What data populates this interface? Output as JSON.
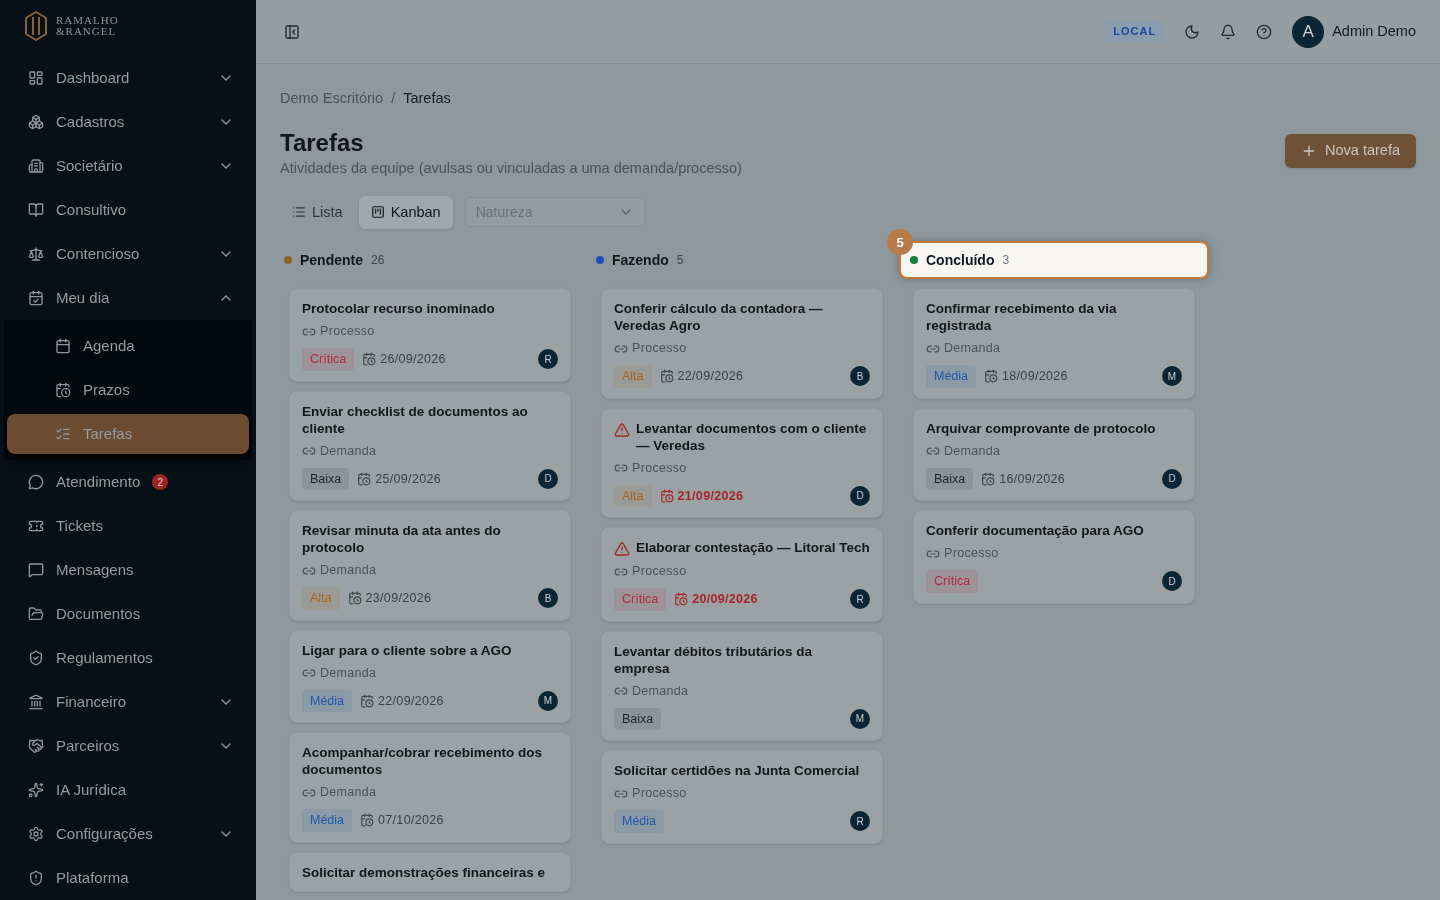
{
  "sidebar": {
    "logo": [
      "RAMALHO",
      "&RANGEL"
    ],
    "items": [
      {
        "label": "Dashboard",
        "expandable": true,
        "expanded": false,
        "selected": false
      },
      {
        "label": "Cadastros",
        "expandable": true,
        "expanded": false,
        "selected": false
      },
      {
        "label": "Societário",
        "expandable": true,
        "expanded": false,
        "selected": false
      },
      {
        "label": "Consultivo",
        "expandable": false,
        "selected": false
      },
      {
        "label": "Contencioso",
        "expandable": true,
        "expanded": false,
        "selected": false
      },
      {
        "label": "Meu dia",
        "expandable": true,
        "expanded": true,
        "selected": false,
        "children": [
          {
            "label": "Agenda",
            "selected": false
          },
          {
            "label": "Prazos",
            "selected": false
          },
          {
            "label": "Tarefas",
            "selected": true
          }
        ]
      },
      {
        "label": "Atendimento",
        "expandable": false,
        "selected": false,
        "badge": "2"
      },
      {
        "label": "Tickets",
        "expandable": false,
        "selected": false
      },
      {
        "label": "Mensagens",
        "expandable": false,
        "selected": false
      },
      {
        "label": "Documentos",
        "expandable": false,
        "selected": false
      },
      {
        "label": "Regulamentos",
        "expandable": false,
        "selected": false
      },
      {
        "label": "Financeiro",
        "expandable": true,
        "expanded": false,
        "selected": false
      },
      {
        "label": "Parceiros",
        "expandable": true,
        "expanded": false,
        "selected": false
      },
      {
        "label": "IA Jurídica",
        "expandable": false,
        "selected": false
      },
      {
        "label": "Configurações",
        "expandable": true,
        "expanded": false,
        "selected": false
      },
      {
        "label": "Plataforma",
        "expandable": false,
        "selected": false
      }
    ]
  },
  "topbar": {
    "environment": "LOCAL",
    "user_initial": "A",
    "user_name": "Admin Demo"
  },
  "breadcrumb": {
    "items": [
      "Demo Escritório",
      "Tarefas"
    ],
    "separator": "/"
  },
  "title": "Tarefas",
  "subtitle": "Atividades da equipe (avulsas ou vinculadas a uma demanda/processo)",
  "new_button": "Nova tarefa",
  "views": [
    {
      "label": "Lista",
      "selected": false
    },
    {
      "label": "Kanban",
      "selected": true
    }
  ],
  "filter": {
    "placeholder": "Natureza"
  },
  "tour": {
    "step": "5"
  },
  "columns": [
    {
      "name": "Pendente",
      "count": "26",
      "color": "#8a6424",
      "highlighted": false,
      "cards": [
        {
          "title": "Protocolar recurso inominado",
          "overdue": false,
          "link": "Processo",
          "priority": {
            "label": "Crítica",
            "color": "#b3283f"
          },
          "date": "26/09/2026",
          "assignee": "R"
        },
        {
          "title": "Enviar checklist de documentos ao cliente",
          "overdue": false,
          "link": "Demanda",
          "priority": {
            "label": "Baixa",
            "color": "#1e2428"
          },
          "date": "25/09/2026",
          "assignee": "D"
        },
        {
          "title": "Revisar minuta da ata antes do protocolo",
          "overdue": false,
          "link": "Demanda",
          "priority": {
            "label": "Alta",
            "color": "#a8641c"
          },
          "date": "23/09/2026",
          "assignee": "B"
        },
        {
          "title": "Ligar para o cliente sobre a AGO",
          "overdue": false,
          "link": "Demanda",
          "priority": {
            "label": "Média",
            "color": "#1f58b0"
          },
          "date": "22/09/2026",
          "assignee": "M"
        },
        {
          "title": "Acompanhar/cobrar recebimento dos documentos",
          "overdue": false,
          "link": "Demanda",
          "priority": {
            "label": "Média",
            "color": "#1f58b0"
          },
          "date": "07/10/2026"
        },
        {
          "title": "Solicitar demonstrações financeiras e",
          "overdue": false
        }
      ]
    },
    {
      "name": "Fazendo",
      "count": "5",
      "color": "#1e4fc0",
      "highlighted": false,
      "cards": [
        {
          "title": "Conferir cálculo da contadora — Veredas Agro",
          "overdue": false,
          "link": "Processo",
          "priority": {
            "label": "Alta",
            "color": "#a8641c"
          },
          "date": "22/09/2026",
          "assignee": "B"
        },
        {
          "title": "Levantar documentos com o cliente — Veredas",
          "overdue": true,
          "link": "Processo",
          "priority": {
            "label": "Alta",
            "color": "#a8641c"
          },
          "date": "21/09/2026",
          "assignee": "D"
        },
        {
          "title": "Elaborar contestação — Litoral Tech",
          "overdue": true,
          "link": "Processo",
          "priority": {
            "label": "Crítica",
            "color": "#b3283f"
          },
          "date": "20/09/2026",
          "assignee": "R"
        },
        {
          "title": "Levantar débitos tributários da empresa",
          "overdue": false,
          "link": "Demanda",
          "priority": {
            "label": "Baixa",
            "color": "#1e2428"
          },
          "assignee": "M"
        },
        {
          "title": "Solicitar certidões na Junta Comercial",
          "overdue": false,
          "link": "Processo",
          "priority": {
            "label": "Média",
            "color": "#1f58b0"
          },
          "assignee": "R"
        }
      ]
    },
    {
      "name": "Concluído",
      "count": "3",
      "color": "#15803d",
      "highlighted": true,
      "cards": [
        {
          "title": "Confirmar recebimento da via registrada",
          "overdue": false,
          "link": "Demanda",
          "priority": {
            "label": "Média",
            "color": "#1f58b0"
          },
          "date": "18/09/2026",
          "assignee": "M"
        },
        {
          "title": "Arquivar comprovante de protocolo",
          "overdue": false,
          "link": "Demanda",
          "priority": {
            "label": "Baixa",
            "color": "#1e2428"
          },
          "date": "16/09/2026",
          "assignee": "D"
        },
        {
          "title": "Conferir documentação para AGO",
          "overdue": false,
          "link": "Processo",
          "priority": {
            "label": "Crítica",
            "color": "#b3283f"
          },
          "assignee": "D"
        }
      ]
    }
  ]
}
